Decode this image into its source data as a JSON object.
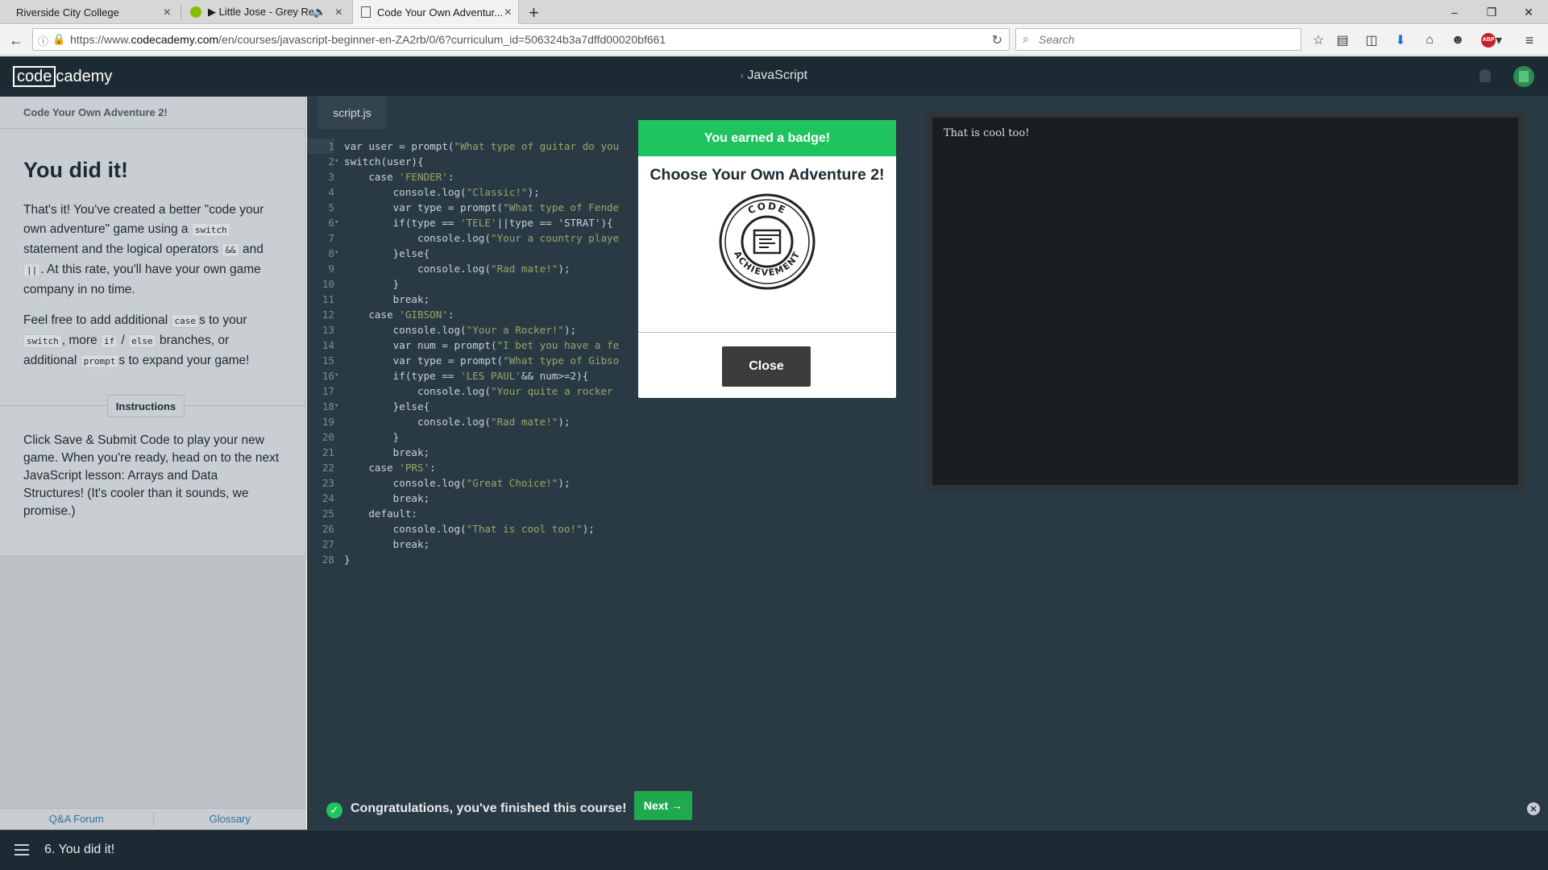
{
  "browser": {
    "tabs": [
      {
        "label": "Riverside City College",
        "active": false
      },
      {
        "label": "▶ Little Jose - Grey Re...",
        "active": false
      },
      {
        "label": "Code Your Own Adventur...",
        "active": true
      }
    ],
    "url_prefix": "https://www.",
    "url_domain": "codecademy.com",
    "url_rest": "/en/courses/javascript-beginner-en-ZA2rb/0/6?curriculum_id=506324b3a7dffd00020bf661",
    "search_placeholder": "Search",
    "new_tab": "+",
    "window_controls": [
      "–",
      "❐",
      "✕"
    ]
  },
  "header": {
    "logo_boxed": "code",
    "logo_rest": "cademy",
    "course_title": "JavaScript"
  },
  "left": {
    "lesson_title": "Code Your Own Adventure 2!",
    "heading": "You did it!",
    "p1_a": "That's it! You've created a better \"code your own adventure\" game using a ",
    "p1_code1": "switch",
    "p1_b": " statement and the logical operators ",
    "p1_code2": "&&",
    "p1_c": " and ",
    "p1_code3": "||",
    "p1_d": ". At this rate, you'll have your own game company in no time.",
    "p2_a": "Feel free to add additional ",
    "p2_code1": "case",
    "p2_b": "s to your ",
    "p2_code2": "switch",
    "p2_c": ", more ",
    "p2_code3": "if",
    "p2_d": " / ",
    "p2_code4": "else",
    "p2_e": " branches, or additional ",
    "p2_code5": "prompt",
    "p2_f": "s to expand your game!",
    "instructions_label": "Instructions",
    "instructions_text": "Click Save & Submit Code to play your new game. When you're ready, head on to the next JavaScript lesson: Arrays and Data Structures! (It's cooler than it sounds, we promise.)",
    "footer_links": [
      "Q&A Forum",
      "Glossary"
    ]
  },
  "editor": {
    "filename": "script.js",
    "lines": [
      {
        "n": "1",
        "fold": "",
        "pre": "var user = prompt(",
        "str": "\"What type of guitar do you",
        "post": ""
      },
      {
        "n": "2",
        "fold": "▾",
        "pre": "switch(user){",
        "str": "",
        "post": ""
      },
      {
        "n": "3",
        "fold": "",
        "pre": "    case ",
        "str": "'FENDER'",
        "post": ":"
      },
      {
        "n": "4",
        "fold": "",
        "pre": "        console.log(",
        "str": "\"Classic!\"",
        "post": ");"
      },
      {
        "n": "5",
        "fold": "",
        "pre": "        var type = prompt(",
        "str": "\"What type of Fende",
        "post": ""
      },
      {
        "n": "6",
        "fold": "▾",
        "pre": "        if(type == ",
        "str": "'TELE'",
        "post": "||type == 'STRAT'){"
      },
      {
        "n": "7",
        "fold": "",
        "pre": "            console.log(",
        "str": "\"Your a country playe",
        "post": ""
      },
      {
        "n": "8",
        "fold": "▾",
        "pre": "        }else{",
        "str": "",
        "post": ""
      },
      {
        "n": "9",
        "fold": "",
        "pre": "            console.log(",
        "str": "\"Rad mate!\"",
        "post": ");"
      },
      {
        "n": "10",
        "fold": "",
        "pre": "        }",
        "str": "",
        "post": ""
      },
      {
        "n": "11",
        "fold": "",
        "pre": "        break;",
        "str": "",
        "post": ""
      },
      {
        "n": "12",
        "fold": "",
        "pre": "    case ",
        "str": "'GIBSON'",
        "post": ":"
      },
      {
        "n": "13",
        "fold": "",
        "pre": "        console.log(",
        "str": "\"Your a Rocker!\"",
        "post": ");"
      },
      {
        "n": "14",
        "fold": "",
        "pre": "        var num = prompt(",
        "str": "\"I bet you have a fe",
        "post": ""
      },
      {
        "n": "15",
        "fold": "",
        "pre": "        var type = prompt(",
        "str": "\"What type of Gibso",
        "post": ""
      },
      {
        "n": "16",
        "fold": "▾",
        "pre": "        if(type == ",
        "str": "'LES PAUL'",
        "post": "&& num>=2){"
      },
      {
        "n": "17",
        "fold": "",
        "pre": "            console.log(",
        "str": "\"Your quite a rocker",
        "post": ""
      },
      {
        "n": "18",
        "fold": "▾",
        "pre": "        }else{",
        "str": "",
        "post": ""
      },
      {
        "n": "19",
        "fold": "",
        "pre": "            console.log(",
        "str": "\"Rad mate!\"",
        "post": ");"
      },
      {
        "n": "20",
        "fold": "",
        "pre": "        }",
        "str": "",
        "post": ""
      },
      {
        "n": "21",
        "fold": "",
        "pre": "        break;",
        "str": "",
        "post": ""
      },
      {
        "n": "22",
        "fold": "",
        "pre": "    case ",
        "str": "'PRS'",
        "post": ":"
      },
      {
        "n": "23",
        "fold": "",
        "pre": "        console.log(",
        "str": "\"Great Choice!\"",
        "post": ");"
      },
      {
        "n": "24",
        "fold": "",
        "pre": "        break;",
        "str": "",
        "post": ""
      },
      {
        "n": "25",
        "fold": "",
        "pre": "    default:",
        "str": "",
        "post": ""
      },
      {
        "n": "26",
        "fold": "",
        "pre": "        console.log(",
        "str": "\"That is cool too!\"",
        "post": ");"
      },
      {
        "n": "27",
        "fold": "",
        "pre": "        break;",
        "str": "",
        "post": ""
      },
      {
        "n": "28",
        "fold": "",
        "pre": "}",
        "str": "",
        "post": ""
      }
    ]
  },
  "output": {
    "text": "That is cool too!"
  },
  "modal": {
    "header": "You earned a badge!",
    "title": "Choose Your Own Adventure 2!",
    "badge_top": "CODE",
    "badge_bottom": "ACHIEVEMENT",
    "close_label": "Close"
  },
  "congrats": {
    "text": "Congratulations, you've finished this course!",
    "next_label": "Next →",
    "close_glyph": "✕"
  },
  "bottom": {
    "label": "6. You did it!"
  },
  "colors": {
    "accent_green": "#1fc45e",
    "header_bg": "#1c2b33",
    "editor_bg": "#2a3a44"
  }
}
